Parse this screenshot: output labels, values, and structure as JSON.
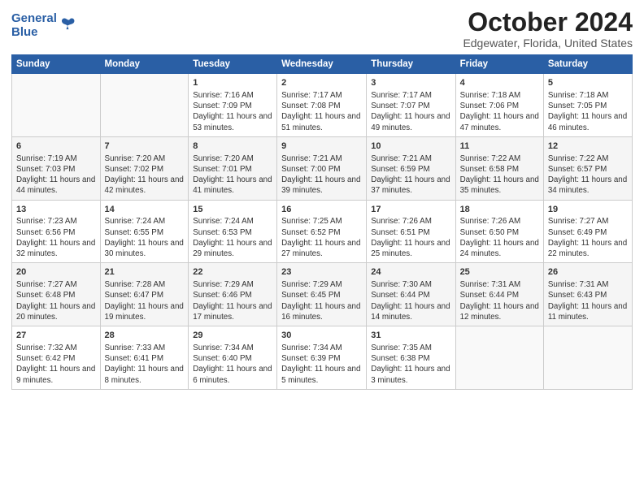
{
  "header": {
    "logo_line1": "General",
    "logo_line2": "Blue",
    "title": "October 2024",
    "subtitle": "Edgewater, Florida, United States"
  },
  "days_of_week": [
    "Sunday",
    "Monday",
    "Tuesday",
    "Wednesday",
    "Thursday",
    "Friday",
    "Saturday"
  ],
  "weeks": [
    [
      {
        "day": "",
        "sunrise": "",
        "sunset": "",
        "daylight": ""
      },
      {
        "day": "",
        "sunrise": "",
        "sunset": "",
        "daylight": ""
      },
      {
        "day": "1",
        "sunrise": "Sunrise: 7:16 AM",
        "sunset": "Sunset: 7:09 PM",
        "daylight": "Daylight: 11 hours and 53 minutes."
      },
      {
        "day": "2",
        "sunrise": "Sunrise: 7:17 AM",
        "sunset": "Sunset: 7:08 PM",
        "daylight": "Daylight: 11 hours and 51 minutes."
      },
      {
        "day": "3",
        "sunrise": "Sunrise: 7:17 AM",
        "sunset": "Sunset: 7:07 PM",
        "daylight": "Daylight: 11 hours and 49 minutes."
      },
      {
        "day": "4",
        "sunrise": "Sunrise: 7:18 AM",
        "sunset": "Sunset: 7:06 PM",
        "daylight": "Daylight: 11 hours and 47 minutes."
      },
      {
        "day": "5",
        "sunrise": "Sunrise: 7:18 AM",
        "sunset": "Sunset: 7:05 PM",
        "daylight": "Daylight: 11 hours and 46 minutes."
      }
    ],
    [
      {
        "day": "6",
        "sunrise": "Sunrise: 7:19 AM",
        "sunset": "Sunset: 7:03 PM",
        "daylight": "Daylight: 11 hours and 44 minutes."
      },
      {
        "day": "7",
        "sunrise": "Sunrise: 7:20 AM",
        "sunset": "Sunset: 7:02 PM",
        "daylight": "Daylight: 11 hours and 42 minutes."
      },
      {
        "day": "8",
        "sunrise": "Sunrise: 7:20 AM",
        "sunset": "Sunset: 7:01 PM",
        "daylight": "Daylight: 11 hours and 41 minutes."
      },
      {
        "day": "9",
        "sunrise": "Sunrise: 7:21 AM",
        "sunset": "Sunset: 7:00 PM",
        "daylight": "Daylight: 11 hours and 39 minutes."
      },
      {
        "day": "10",
        "sunrise": "Sunrise: 7:21 AM",
        "sunset": "Sunset: 6:59 PM",
        "daylight": "Daylight: 11 hours and 37 minutes."
      },
      {
        "day": "11",
        "sunrise": "Sunrise: 7:22 AM",
        "sunset": "Sunset: 6:58 PM",
        "daylight": "Daylight: 11 hours and 35 minutes."
      },
      {
        "day": "12",
        "sunrise": "Sunrise: 7:22 AM",
        "sunset": "Sunset: 6:57 PM",
        "daylight": "Daylight: 11 hours and 34 minutes."
      }
    ],
    [
      {
        "day": "13",
        "sunrise": "Sunrise: 7:23 AM",
        "sunset": "Sunset: 6:56 PM",
        "daylight": "Daylight: 11 hours and 32 minutes."
      },
      {
        "day": "14",
        "sunrise": "Sunrise: 7:24 AM",
        "sunset": "Sunset: 6:55 PM",
        "daylight": "Daylight: 11 hours and 30 minutes."
      },
      {
        "day": "15",
        "sunrise": "Sunrise: 7:24 AM",
        "sunset": "Sunset: 6:53 PM",
        "daylight": "Daylight: 11 hours and 29 minutes."
      },
      {
        "day": "16",
        "sunrise": "Sunrise: 7:25 AM",
        "sunset": "Sunset: 6:52 PM",
        "daylight": "Daylight: 11 hours and 27 minutes."
      },
      {
        "day": "17",
        "sunrise": "Sunrise: 7:26 AM",
        "sunset": "Sunset: 6:51 PM",
        "daylight": "Daylight: 11 hours and 25 minutes."
      },
      {
        "day": "18",
        "sunrise": "Sunrise: 7:26 AM",
        "sunset": "Sunset: 6:50 PM",
        "daylight": "Daylight: 11 hours and 24 minutes."
      },
      {
        "day": "19",
        "sunrise": "Sunrise: 7:27 AM",
        "sunset": "Sunset: 6:49 PM",
        "daylight": "Daylight: 11 hours and 22 minutes."
      }
    ],
    [
      {
        "day": "20",
        "sunrise": "Sunrise: 7:27 AM",
        "sunset": "Sunset: 6:48 PM",
        "daylight": "Daylight: 11 hours and 20 minutes."
      },
      {
        "day": "21",
        "sunrise": "Sunrise: 7:28 AM",
        "sunset": "Sunset: 6:47 PM",
        "daylight": "Daylight: 11 hours and 19 minutes."
      },
      {
        "day": "22",
        "sunrise": "Sunrise: 7:29 AM",
        "sunset": "Sunset: 6:46 PM",
        "daylight": "Daylight: 11 hours and 17 minutes."
      },
      {
        "day": "23",
        "sunrise": "Sunrise: 7:29 AM",
        "sunset": "Sunset: 6:45 PM",
        "daylight": "Daylight: 11 hours and 16 minutes."
      },
      {
        "day": "24",
        "sunrise": "Sunrise: 7:30 AM",
        "sunset": "Sunset: 6:44 PM",
        "daylight": "Daylight: 11 hours and 14 minutes."
      },
      {
        "day": "25",
        "sunrise": "Sunrise: 7:31 AM",
        "sunset": "Sunset: 6:44 PM",
        "daylight": "Daylight: 11 hours and 12 minutes."
      },
      {
        "day": "26",
        "sunrise": "Sunrise: 7:31 AM",
        "sunset": "Sunset: 6:43 PM",
        "daylight": "Daylight: 11 hours and 11 minutes."
      }
    ],
    [
      {
        "day": "27",
        "sunrise": "Sunrise: 7:32 AM",
        "sunset": "Sunset: 6:42 PM",
        "daylight": "Daylight: 11 hours and 9 minutes."
      },
      {
        "day": "28",
        "sunrise": "Sunrise: 7:33 AM",
        "sunset": "Sunset: 6:41 PM",
        "daylight": "Daylight: 11 hours and 8 minutes."
      },
      {
        "day": "29",
        "sunrise": "Sunrise: 7:34 AM",
        "sunset": "Sunset: 6:40 PM",
        "daylight": "Daylight: 11 hours and 6 minutes."
      },
      {
        "day": "30",
        "sunrise": "Sunrise: 7:34 AM",
        "sunset": "Sunset: 6:39 PM",
        "daylight": "Daylight: 11 hours and 5 minutes."
      },
      {
        "day": "31",
        "sunrise": "Sunrise: 7:35 AM",
        "sunset": "Sunset: 6:38 PM",
        "daylight": "Daylight: 11 hours and 3 minutes."
      },
      {
        "day": "",
        "sunrise": "",
        "sunset": "",
        "daylight": ""
      },
      {
        "day": "",
        "sunrise": "",
        "sunset": "",
        "daylight": ""
      }
    ]
  ]
}
